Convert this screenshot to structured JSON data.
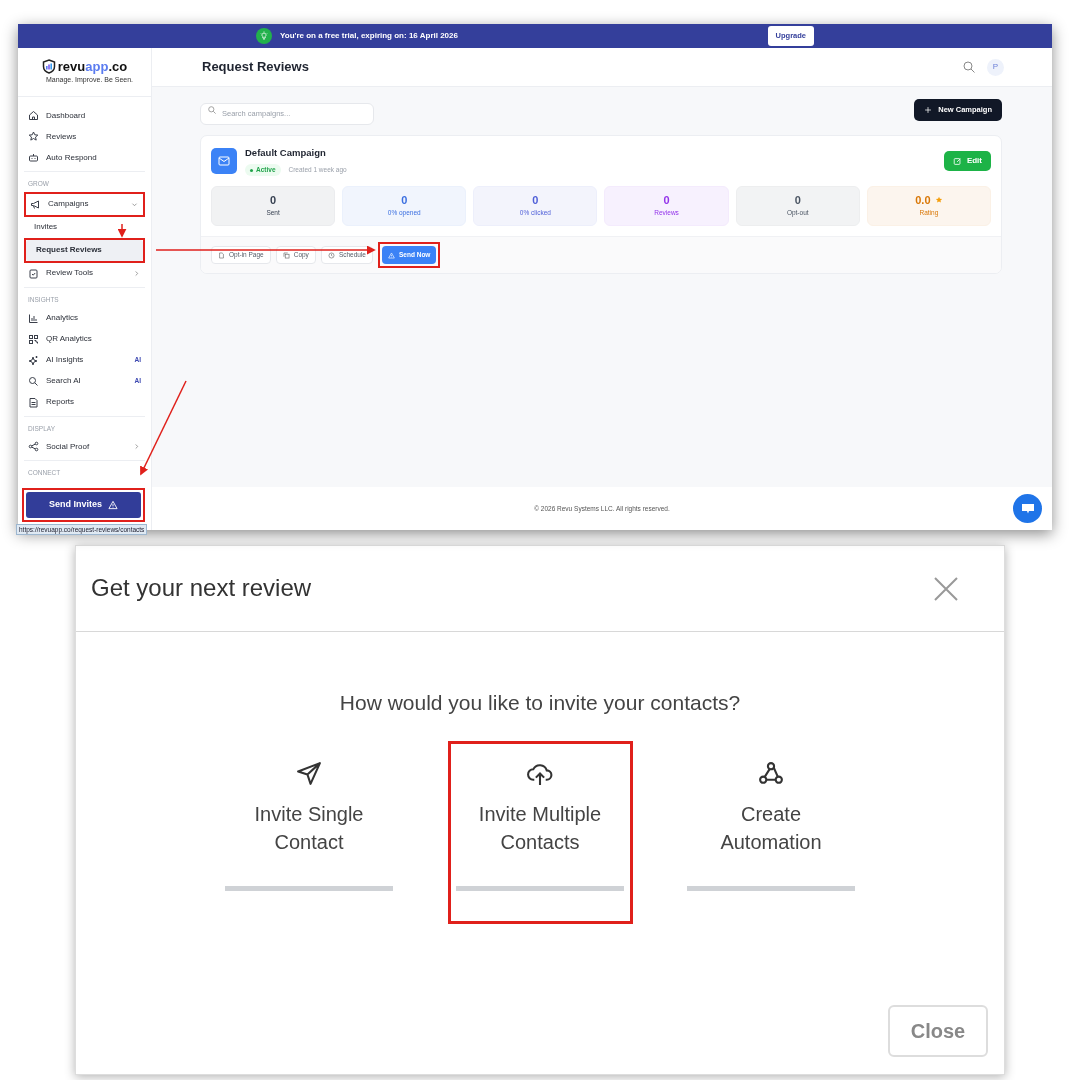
{
  "app_screen": {
    "banner": {
      "message": "You're on a free trial, expiring on: 16 April 2026",
      "button": "Upgrade"
    },
    "logo": {
      "parts": [
        "revu",
        "app",
        ".co"
      ],
      "tagline": "Manage. Improve. Be Seen."
    },
    "sidebar": {
      "sections": [
        {
          "items": [
            {
              "label": "Dashboard",
              "selected": false
            },
            {
              "label": "Reviews",
              "selected": false
            },
            {
              "label": "Auto Respond",
              "selected": false
            }
          ]
        },
        {
          "heading": "GROW",
          "items": [
            {
              "label": "Campaigns",
              "selected": false,
              "expanded": true,
              "highlighted": true,
              "children": [
                {
                  "label": "Invites",
                  "selected": false
                },
                {
                  "label": "Request Reviews",
                  "selected": true,
                  "highlighted": true
                }
              ]
            },
            {
              "label": "Review Tools",
              "selected": false,
              "expanded": false
            }
          ]
        },
        {
          "heading": "INSIGHTS",
          "items": [
            {
              "label": "Analytics",
              "selected": false
            },
            {
              "label": "QR Analytics",
              "selected": false
            },
            {
              "label": "AI Insights",
              "selected": false,
              "badge": "AI"
            },
            {
              "label": "Search AI",
              "selected": false,
              "badge": "AI"
            },
            {
              "label": "Reports",
              "selected": false
            }
          ]
        },
        {
          "heading": "DISPLAY",
          "items": [
            {
              "label": "Social Proof",
              "selected": false,
              "expanded": false
            }
          ]
        },
        {
          "heading": "CONNECT"
        }
      ],
      "send_button": {
        "label": "Send Invites",
        "highlighted": true
      }
    },
    "link_preview": "https://revuapp.co/request-reviews/contacts",
    "header": {
      "title": "Request Reviews",
      "avatar": "P"
    },
    "search": {
      "placeholder": "Search campaigns..."
    },
    "new_button": "New Campaign",
    "campaign": {
      "name": "Default Campaign",
      "status": "Active",
      "created": "Created 1 week ago",
      "edit": "Edit",
      "stats": [
        {
          "value": "0",
          "label": "Sent",
          "color": "#374151"
        },
        {
          "value": "0",
          "label": "0% opened",
          "color": "#3b6fe0"
        },
        {
          "value": "0",
          "label": "0% clicked",
          "color": "#4f5fd8"
        },
        {
          "value": "0",
          "label": "Reviews",
          "color": "#9333ea"
        },
        {
          "value": "0",
          "label": "Opt-out",
          "color": "#4b5563"
        },
        {
          "value": "0.0",
          "label": "Rating",
          "color": "#d97706",
          "kind": "rating"
        }
      ],
      "actions": [
        {
          "label": "Opt-in Page",
          "kind": "outline"
        },
        {
          "label": "Copy",
          "kind": "outline"
        },
        {
          "label": "Schedule",
          "kind": "outline"
        },
        {
          "label": "Send Now",
          "kind": "primary",
          "highlighted": true
        }
      ]
    },
    "footer": "© 2026 Revu Systems LLC. All rights reserved."
  },
  "modal": {
    "title": "Get your next review",
    "question": "How would you like to invite your contacts?",
    "options": [
      {
        "label": "Invite Single Contact",
        "highlighted": false
      },
      {
        "label": "Invite Multiple Contacts",
        "highlighted": true
      },
      {
        "label": "Create Automation",
        "highlighted": false
      }
    ],
    "close_button": "Close"
  }
}
